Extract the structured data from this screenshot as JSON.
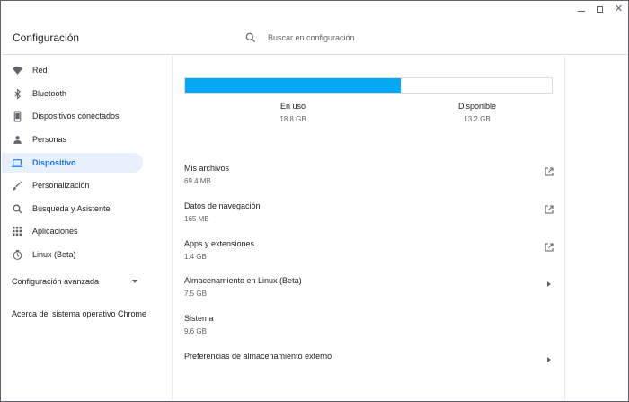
{
  "window": {
    "minimize": "",
    "maximize": "",
    "close": "✕"
  },
  "header": {
    "title": "Configuración",
    "search_placeholder": "Buscar en configuración"
  },
  "sidebar": {
    "items": [
      {
        "label": "Red",
        "icon": "wifi-icon"
      },
      {
        "label": "Bluetooth",
        "icon": "bluetooth-icon"
      },
      {
        "label": "Dispositivos conectados",
        "icon": "phone-icon"
      },
      {
        "label": "Personas",
        "icon": "person-icon"
      },
      {
        "label": "Dispositivo",
        "icon": "laptop-icon",
        "active": true
      },
      {
        "label": "Personalización",
        "icon": "brush-icon"
      },
      {
        "label": "Búsqueda y Asistente",
        "icon": "search-icon"
      },
      {
        "label": "Aplicaciones",
        "icon": "apps-grid-icon"
      },
      {
        "label": "Linux (Beta)",
        "icon": "linux-icon"
      }
    ],
    "advanced": "Configuración avanzada",
    "about": "Acerca del sistema operativo Chrome"
  },
  "storage": {
    "used_fraction": 0.588,
    "used_label": "En uso",
    "used_value": "18.8 GB",
    "available_label": "Disponible",
    "available_value": "13.2 GB",
    "bar_color": "#03a9f4"
  },
  "rows": [
    {
      "title": "Mis archivos",
      "sub": "69.4 MB",
      "action": "open-external-icon"
    },
    {
      "title": "Datos de navegación",
      "sub": "165 MB",
      "action": "open-external-icon"
    },
    {
      "title": "Apps y extensiones",
      "sub": "1.4 GB",
      "action": "open-external-icon"
    },
    {
      "title": "Almacenamiento en Linux (Beta)",
      "sub": "7.5 GB",
      "action": "arrow-right-icon"
    },
    {
      "title": "Sistema",
      "sub": "9.6 GB",
      "action": ""
    },
    {
      "title": "Preferencias de almacenamiento externo",
      "sub": "",
      "action": "arrow-right-icon"
    }
  ],
  "accent_color": "#1a73e8"
}
